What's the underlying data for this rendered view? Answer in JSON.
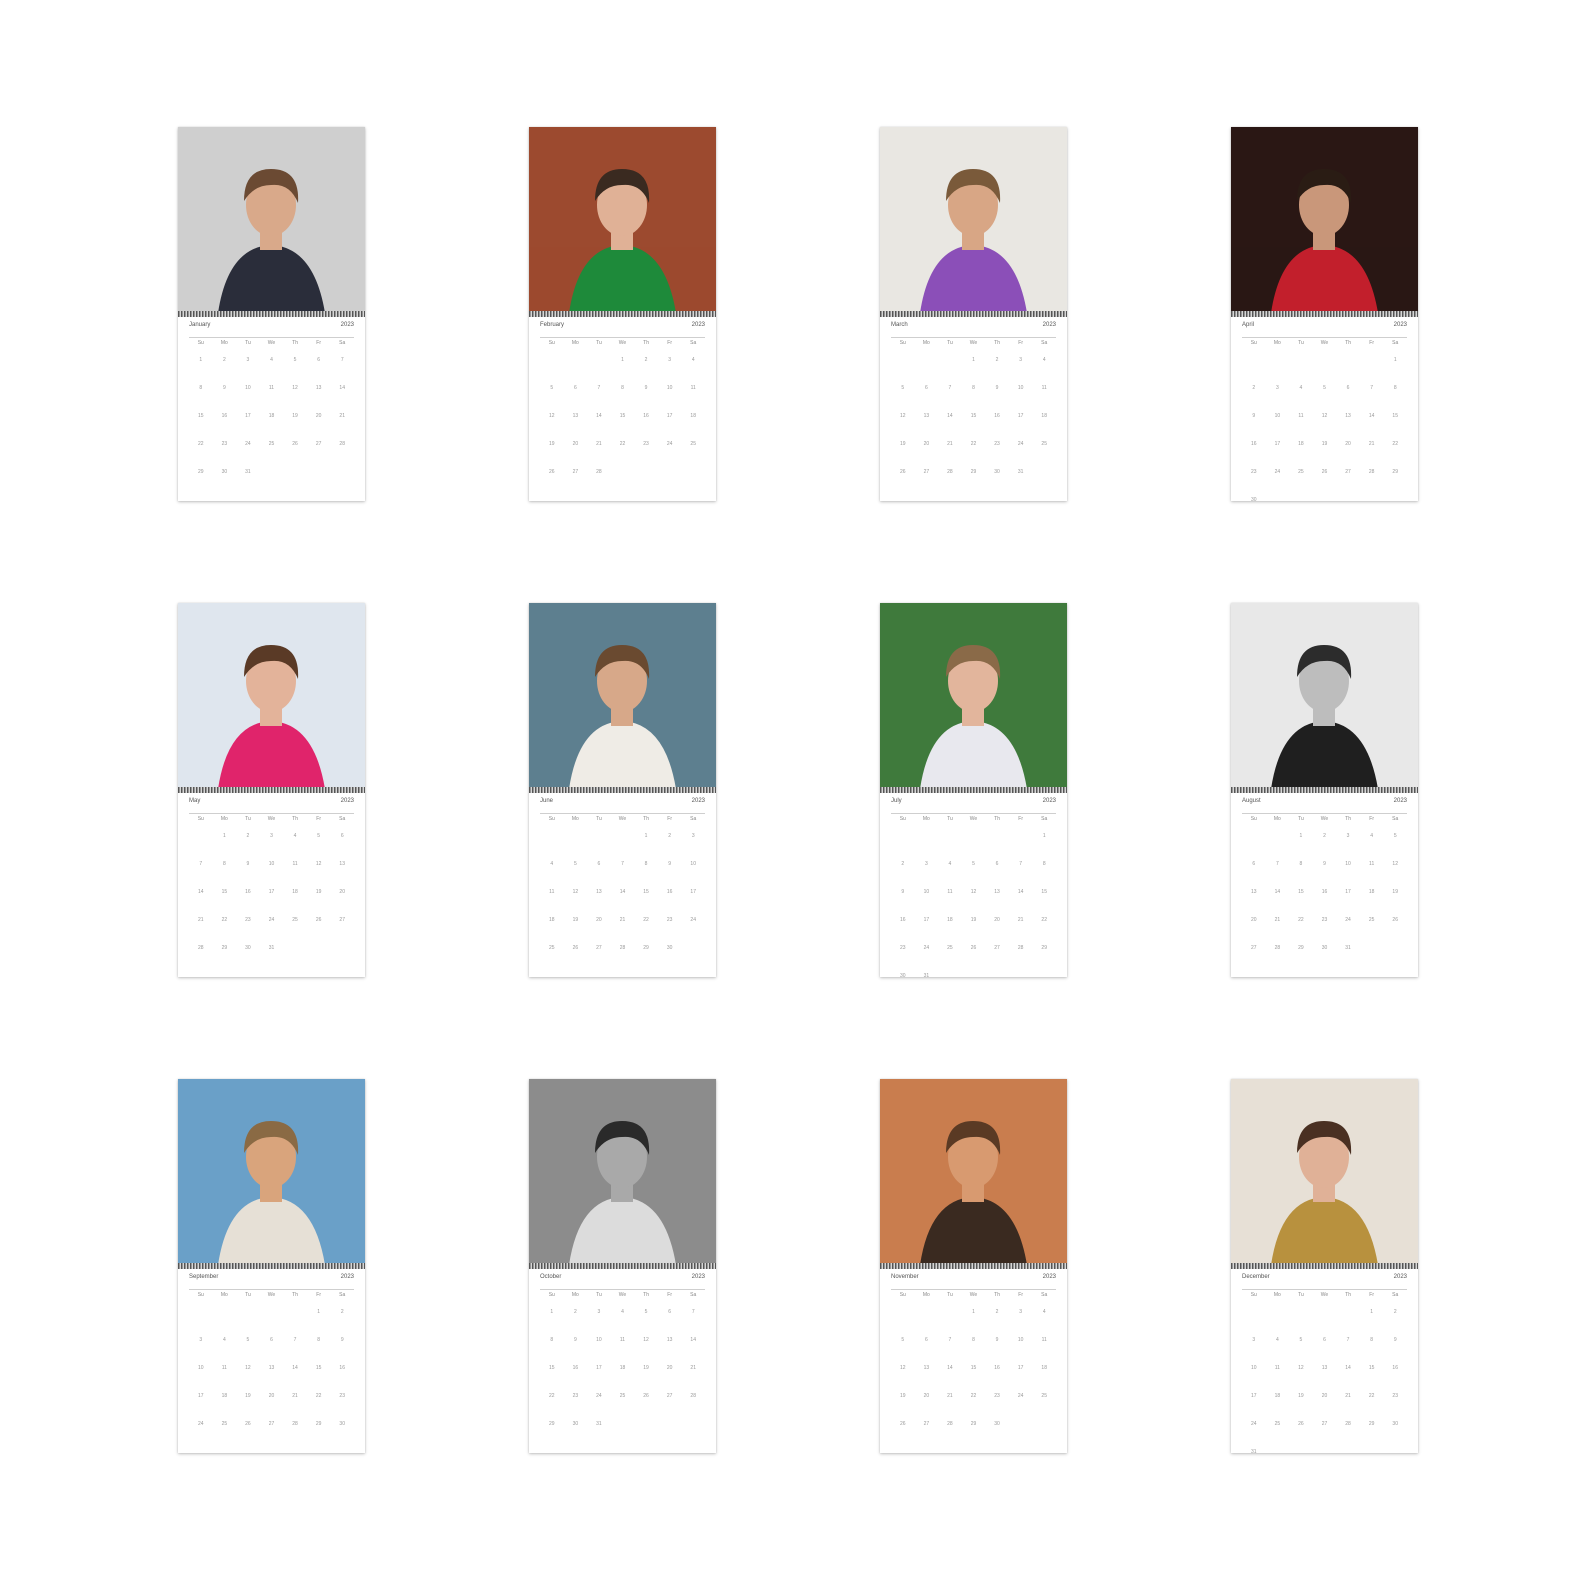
{
  "calendar": {
    "year": "2023",
    "weekdays": [
      "Su",
      "Mo",
      "Tu",
      "We",
      "Th",
      "Fr",
      "Sa"
    ],
    "months": [
      {
        "name": "January",
        "start": 0,
        "length": 31,
        "photo": {
          "bg": "#cfcfcf",
          "accent": "#2a2d3a",
          "skin": "#d9a98a",
          "hair": "#6b4a33"
        }
      },
      {
        "name": "February",
        "start": 3,
        "length": 28,
        "photo": {
          "bg": "#9c4a2f",
          "accent": "#1e8a3a",
          "skin": "#e0b196",
          "hair": "#3a2a20"
        }
      },
      {
        "name": "March",
        "start": 3,
        "length": 31,
        "photo": {
          "bg": "#e9e7e2",
          "accent": "#8b4fb8",
          "skin": "#d8a685",
          "hair": "#7a5a3a"
        }
      },
      {
        "name": "April",
        "start": 6,
        "length": 30,
        "photo": {
          "bg": "#2a1714",
          "accent": "#c21f2c",
          "skin": "#c9977a",
          "hair": "#2a1c14"
        }
      },
      {
        "name": "May",
        "start": 1,
        "length": 31,
        "photo": {
          "bg": "#dfe6ee",
          "accent": "#e0246b",
          "skin": "#e3b39a",
          "hair": "#5a3a26"
        }
      },
      {
        "name": "June",
        "start": 4,
        "length": 30,
        "photo": {
          "bg": "#5d7f8f",
          "accent": "#efece6",
          "skin": "#d7a889",
          "hair": "#6a4a30"
        }
      },
      {
        "name": "July",
        "start": 6,
        "length": 31,
        "photo": {
          "bg": "#3f7a3c",
          "accent": "#e8e8ee",
          "skin": "#e2b59c",
          "hair": "#8a6a48"
        }
      },
      {
        "name": "August",
        "start": 2,
        "length": 31,
        "photo": {
          "bg": "#e8e8e8",
          "accent": "#1f1f1f",
          "skin": "#bdbdbd",
          "hair": "#2c2c2c"
        }
      },
      {
        "name": "September",
        "start": 5,
        "length": 30,
        "photo": {
          "bg": "#6aa0c8",
          "accent": "#e6e0d6",
          "skin": "#d9a47c",
          "hair": "#8a6a44"
        }
      },
      {
        "name": "October",
        "start": 0,
        "length": 31,
        "photo": {
          "bg": "#8c8c8c",
          "accent": "#dcdcdc",
          "skin": "#a9a9a9",
          "hair": "#2a2a2a"
        }
      },
      {
        "name": "November",
        "start": 3,
        "length": 30,
        "photo": {
          "bg": "#c97d4e",
          "accent": "#3a2a20",
          "skin": "#d89a70",
          "hair": "#5a3a24"
        }
      },
      {
        "name": "December",
        "start": 5,
        "length": 31,
        "photo": {
          "bg": "#e7e0d6",
          "accent": "#b8913e",
          "skin": "#e0b197",
          "hair": "#4a3022"
        }
      }
    ]
  }
}
